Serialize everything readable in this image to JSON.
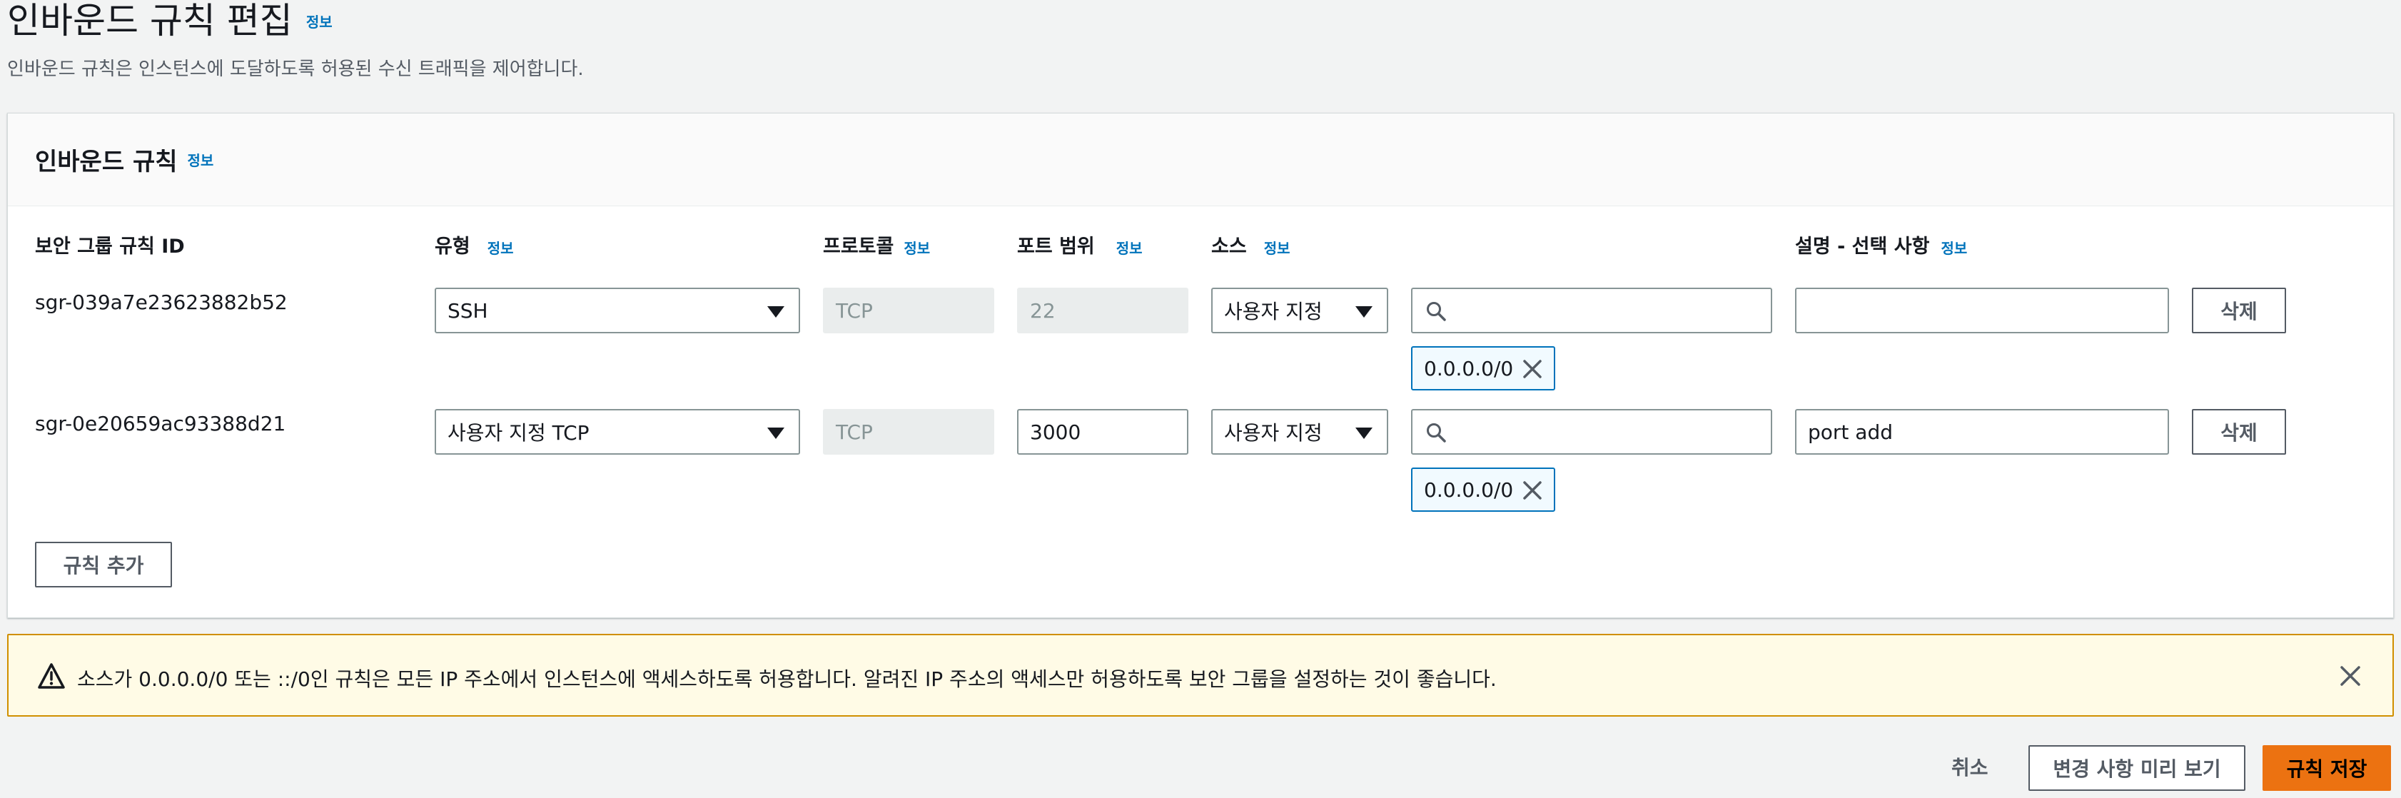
{
  "header": {
    "title": "인바운드 규칙 편집",
    "info": "정보",
    "description": "인바운드 규칙은 인스턴스에 도달하도록 허용된 수신 트래픽을 제어합니다."
  },
  "panel": {
    "title": "인바운드 규칙",
    "info": "정보",
    "columns": {
      "rule_id": "보안 그룹 규칙 ID",
      "type": "유형",
      "protocol": "프로토콜",
      "port_range": "포트 범위",
      "source": "소스",
      "description": "설명 - 선택 사항",
      "info": "정보"
    },
    "rules": [
      {
        "id": "sgr-039a7e23623882b52",
        "type": "SSH",
        "protocol": "TCP",
        "port": "22",
        "source_mode": "사용자 지정",
        "search_value": "",
        "cidr_token": "0.0.0.0/0",
        "description": "",
        "delete_label": "삭제"
      },
      {
        "id": "sgr-0e20659ac93388d21",
        "type": "사용자 지정 TCP",
        "protocol": "TCP",
        "port": "3000",
        "source_mode": "사용자 지정",
        "search_value": "",
        "cidr_token": "0.0.0.0/0",
        "description": "port add",
        "delete_label": "삭제"
      }
    ],
    "add_rule_label": "규칙 추가"
  },
  "warning": {
    "text": "소스가 0.0.0.0/0 또는 ::/0인 규칙은 모든 IP 주소에서 인스턴스에 액세스하도록 허용합니다. 알려진 IP 주소의 액세스만 허용하도록 보안 그룹을 설정하는 것이 좋습니다."
  },
  "footer": {
    "cancel_label": "취소",
    "preview_label": "변경 사항 미리 보기",
    "save_label": "규칙 저장"
  },
  "colors": {
    "accent": "#0073bb",
    "primary_button": "#ec7211",
    "warning_border": "#d08f00",
    "warning_bg": "#fffbe6"
  }
}
